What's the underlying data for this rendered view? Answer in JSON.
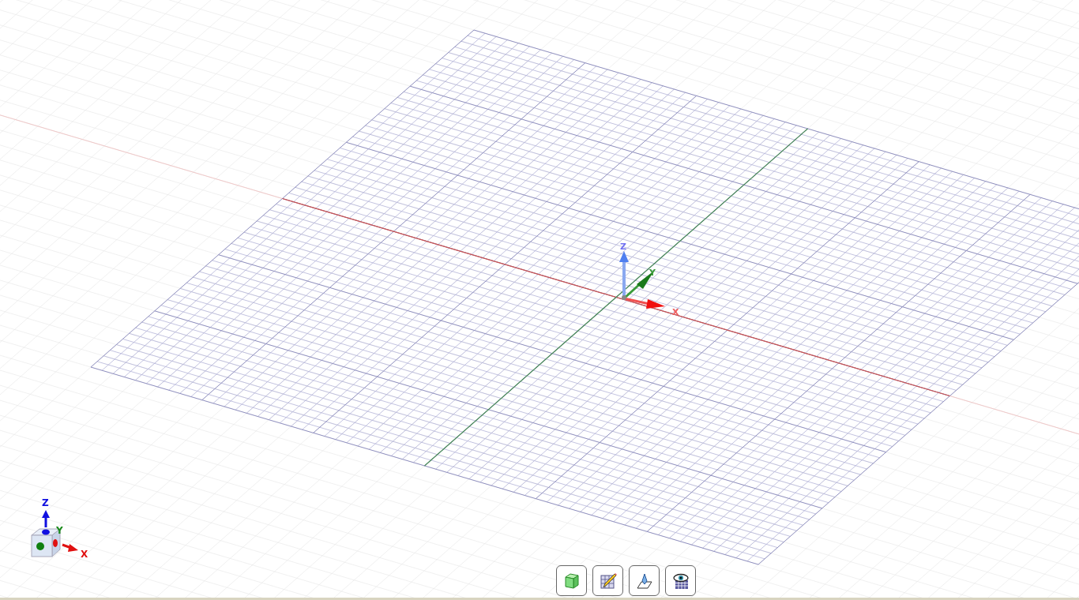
{
  "origin_triad": {
    "z_label": "Z",
    "y_label": "Y",
    "x_label": "X"
  },
  "view_cube": {
    "z_label": "Z",
    "y_label": "Y",
    "x_label": "X"
  },
  "toolbar": [
    {
      "kind": "solid"
    },
    {
      "kind": "sketch"
    },
    {
      "kind": "plane"
    },
    {
      "kind": "view"
    }
  ]
}
